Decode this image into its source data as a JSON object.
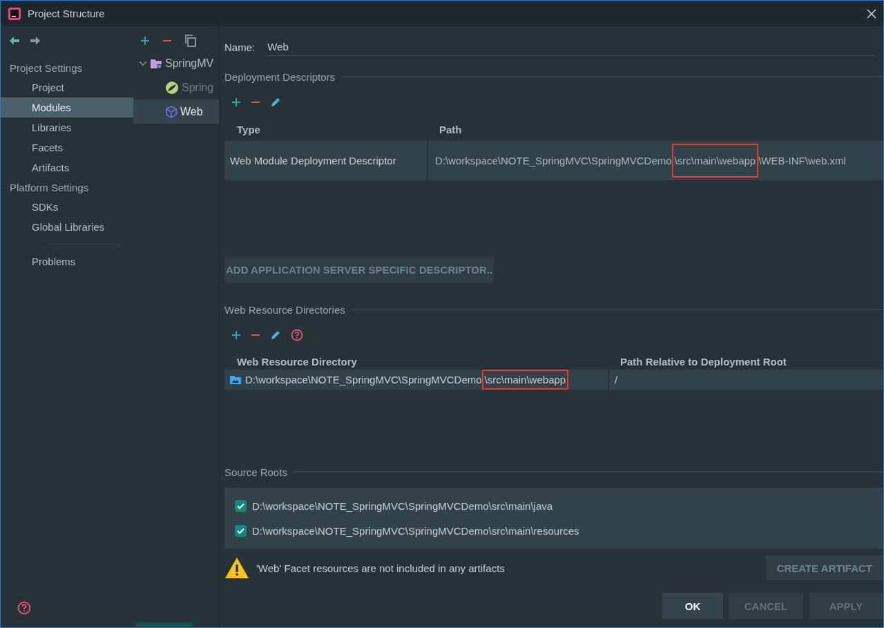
{
  "window": {
    "title": "Project Structure"
  },
  "sidebar": {
    "groups": [
      {
        "title": "Project Settings",
        "items": [
          {
            "label": "Project",
            "selected": false
          },
          {
            "label": "Modules",
            "selected": true
          },
          {
            "label": "Libraries",
            "selected": false
          },
          {
            "label": "Facets",
            "selected": false
          },
          {
            "label": "Artifacts",
            "selected": false
          }
        ]
      },
      {
        "title": "Platform Settings",
        "items": [
          {
            "label": "SDKs",
            "selected": false
          },
          {
            "label": "Global Libraries",
            "selected": false
          }
        ]
      }
    ],
    "extra": [
      {
        "label": "Problems",
        "selected": false
      }
    ]
  },
  "tree": {
    "root": {
      "label": "SpringMV",
      "kind": "module",
      "expanded": true,
      "children": [
        {
          "label": "Spring",
          "kind": "spring",
          "selected": false
        },
        {
          "label": "Web",
          "kind": "web",
          "selected": true
        }
      ]
    }
  },
  "name_field": {
    "label": "Name:",
    "value": "Web"
  },
  "deployment_descriptors": {
    "title": "Deployment Descriptors",
    "columns": [
      "Type",
      "Path"
    ],
    "rows": [
      {
        "type": "Web Module Deployment Descriptor",
        "path": [
          {
            "text": "D:\\workspace\\NOTE_SpringMVC\\SpringMVCDemo",
            "highlighted": false
          },
          {
            "text": "\\src\\main\\webapp",
            "highlighted": true
          },
          {
            "text": "\\WEB-INF\\web.xml",
            "highlighted": false
          }
        ]
      }
    ],
    "button": "ADD APPLICATION SERVER SPECIFIC DESCRIPTOR.."
  },
  "web_resource_directories": {
    "title": "Web Resource Directories",
    "columns": [
      "Web Resource Directory",
      "Path Relative to Deployment Root"
    ],
    "rows": [
      {
        "directory": [
          {
            "text": "D:\\workspace\\NOTE_SpringMVC\\SpringMVCDemo",
            "highlighted": false
          },
          {
            "text": "\\src\\main\\webapp",
            "highlighted": true
          }
        ],
        "relative": "/"
      }
    ]
  },
  "source_roots": {
    "title": "Source Roots",
    "items": [
      {
        "path": "D:\\workspace\\NOTE_SpringMVC\\SpringMVCDemo\\src\\main\\java",
        "checked": true
      },
      {
        "path": "D:\\workspace\\NOTE_SpringMVC\\SpringMVCDemo\\src\\main\\resources",
        "checked": true
      }
    ]
  },
  "warning": {
    "text": "'Web' Facet resources are not included in any artifacts",
    "button": "CREATE ARTIFACT"
  },
  "buttons": [
    {
      "label": "OK",
      "disabled": false
    },
    {
      "label": "CANCEL",
      "disabled": true
    },
    {
      "label": "APPLY",
      "disabled": true
    }
  ]
}
